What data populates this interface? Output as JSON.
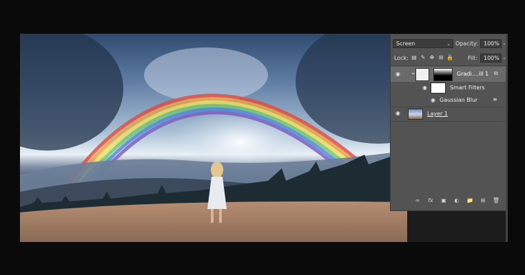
{
  "layers_panel": {
    "blend_mode": "Screen",
    "opacity_label": "Opacity:",
    "opacity_value": "100%",
    "lock_label": "Lock:",
    "fill_label": "Fill:",
    "fill_value": "100%",
    "layers": [
      {
        "name": "Gradi....ill 1",
        "type": "gradient-fill"
      },
      {
        "name": "Smart Filters",
        "type": "smart-filters"
      },
      {
        "name": "Gaussian Blur",
        "type": "filter"
      },
      {
        "name": "Layer 1",
        "type": "pixel-layer"
      }
    ]
  },
  "icons": {
    "eye": "eye-icon",
    "link": "link-icon",
    "fx": "fx",
    "mask": "mask-icon",
    "adjustment": "adjustment-icon",
    "folder": "folder-icon",
    "new_layer": "new-layer-icon",
    "trash": "trash-icon"
  }
}
